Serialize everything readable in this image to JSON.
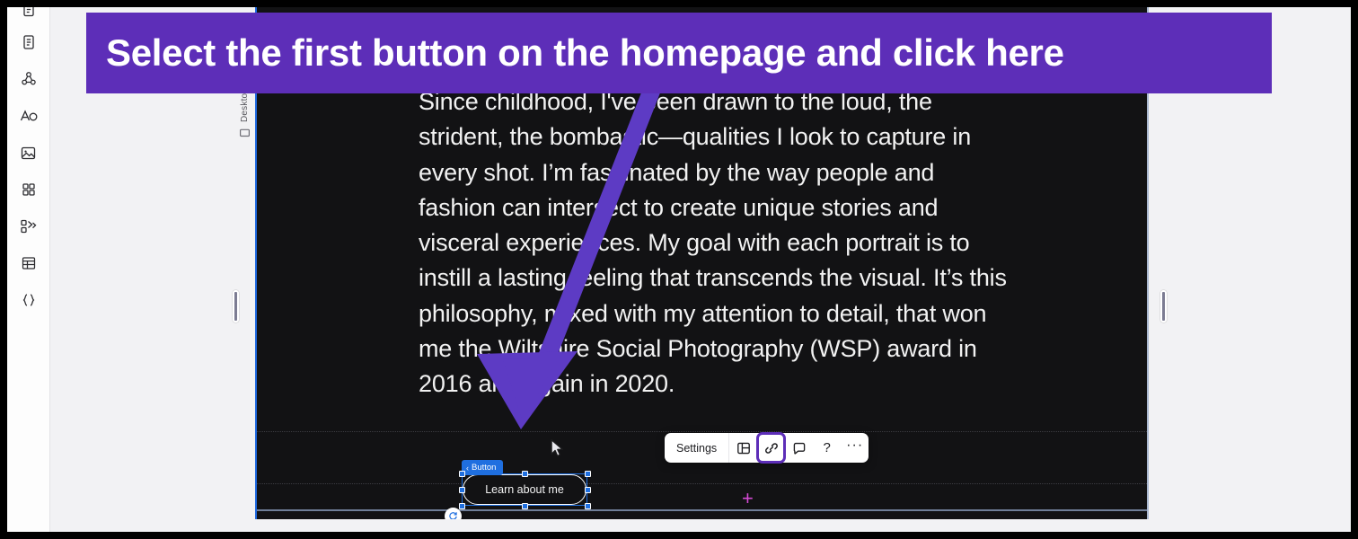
{
  "banner": {
    "text": "Select the first button on the homepage and click here",
    "background_color": "#5D2EB8",
    "text_color": "#FFFFFF"
  },
  "annotation": {
    "arrow_color": "#5D3BC4",
    "arrow_description": "large purple arrow pointing from banner down to the link icon in the element toolbar"
  },
  "left_rail": {
    "items": [
      {
        "icon": "pages-icon",
        "label": "Pages"
      },
      {
        "icon": "components-icon",
        "label": "Components"
      },
      {
        "icon": "typography-icon",
        "label": "Typography"
      },
      {
        "icon": "assets-image-icon",
        "label": "Assets"
      },
      {
        "icon": "apps-grid-icon",
        "label": "Apps"
      },
      {
        "icon": "interactions-icon",
        "label": "Interactions"
      },
      {
        "icon": "cms-table-icon",
        "label": "CMS"
      },
      {
        "icon": "code-braces-icon",
        "label": "Custom code"
      }
    ]
  },
  "viewport": {
    "tab_label": "Desktop",
    "tab_icon": "monitor-icon"
  },
  "canvas": {
    "background_color": "#121214",
    "article_paragraph": "Since childhood, I've been drawn to the loud, the strident, the bombastic—qualities I look to capture in every shot. I’m fascinated by the way people and fashion can intersect to create unique stories and visceral experiences. My goal with each portrait is to instill a lasting feeling that transcends the visual. It’s this philosophy, mixed with my attention to detail, that won me the Wiltshire Social Photography (WSP) award in 2016 and again in 2020.",
    "add_section_marker": "+"
  },
  "element_toolbar": {
    "settings_label": "Settings",
    "buttons": [
      {
        "icon": "layout-panel-icon",
        "name": "layout",
        "active": false
      },
      {
        "icon": "link-icon",
        "name": "link-settings",
        "active": true
      },
      {
        "icon": "comment-icon",
        "name": "comment",
        "active": false
      },
      {
        "icon": "question-mark-icon",
        "name": "help",
        "label": "?",
        "active": false
      },
      {
        "icon": "ellipsis-icon",
        "name": "more-options",
        "label": "···",
        "active": false
      }
    ],
    "highlight_color": "#5D2EB8"
  },
  "selection": {
    "badge_label": "Button",
    "badge_chevron": "‹",
    "badge_color": "#1F6FE0",
    "button_label": "Learn about me",
    "rotate_handle_icon": "rotate-icon"
  }
}
